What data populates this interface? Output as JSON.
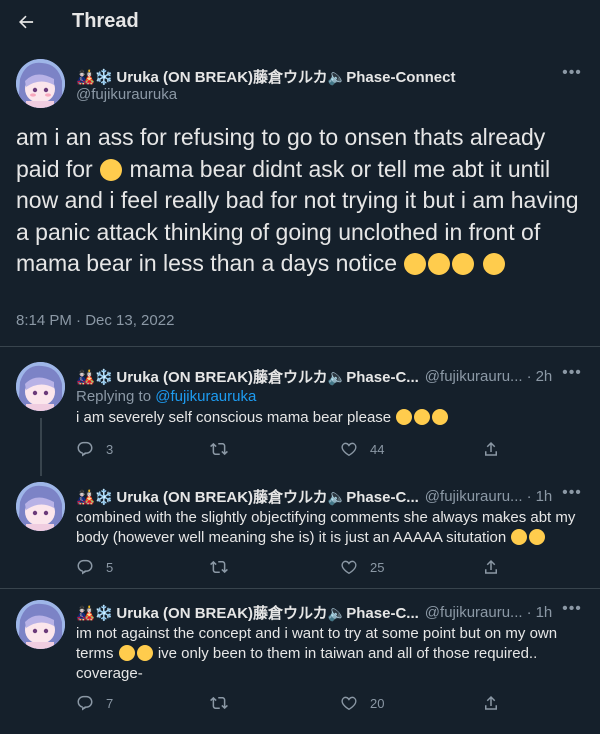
{
  "header": {
    "title": "Thread"
  },
  "author": {
    "name_prefix_icons": "🎎❄️",
    "display_name": "Uruka (ON BREAK)藤倉ウルカ🔈Phase-Connect",
    "display_name_short": "Uruka (ON BREAK)藤倉ウルカ🔈Phase-C...",
    "handle": "@fujikurauruka",
    "handle_short": "@fujikurauru..."
  },
  "main_tweet": {
    "text_1": "am i an ass for refusing to go to onsen thats already paid for",
    "text_2": "mama bear didnt ask or tell me abt it until now and i feel really bad for not trying it but i am having a panic attack thinking of going unclothed in front of mama bear in less than a days notice",
    "timestamp": "8:14 PM · Dec 13, 2022"
  },
  "replies": [
    {
      "time": "2h",
      "replying_prefix": "Replying to",
      "replying_handle": "@fujikurauruka",
      "text": "i am severely self conscious mama bear please",
      "replies": "3",
      "retweets": "",
      "likes": "44"
    },
    {
      "time": "1h",
      "text": "combined with the slightly objectifying comments she always makes abt my body (however well meaning she is) it is just an AAAAA situtation",
      "replies": "5",
      "retweets": "",
      "likes": "25"
    },
    {
      "time": "1h",
      "text_1": "im not against the concept and i want to try at some point but on my own terms",
      "text_2": "ive only been to them in taiwan and all of those required.. coverage-",
      "replies": "7",
      "retweets": "",
      "likes": "20"
    }
  ],
  "icons": {
    "back": "arrow-left-icon",
    "more": "more-horizontal-icon",
    "reply": "reply-icon",
    "retweet": "retweet-icon",
    "like": "heart-icon",
    "share": "share-icon"
  },
  "colors": {
    "background": "#15202b",
    "link": "#1d9bf0",
    "muted": "#8b98a5",
    "divider": "#38444d"
  }
}
